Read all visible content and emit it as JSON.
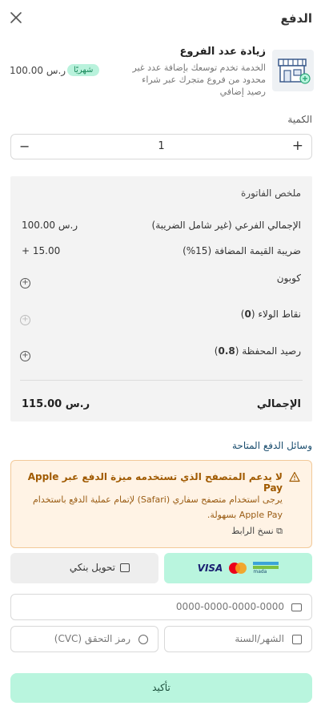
{
  "header": {
    "title": "الدفع",
    "close_icon": "close-icon"
  },
  "product": {
    "name": "زيادة عدد الفروع",
    "description": "الخدمة تخدم توسعك بإضافة عدد غير محدود من فروع متجرك عبر شراء رصيد إضافي",
    "billing_badge": "شهريًا",
    "price": "100.00 ر.س",
    "icon": "store-plus-icon"
  },
  "quantity": {
    "label": "الكمية",
    "value": "1",
    "minus": "−",
    "plus": "+"
  },
  "invoice": {
    "title": "ملخص الفاتورة",
    "subtotal_label": "الإجمالي الفرعي (غير شامل الضريبة)",
    "subtotal_value": "100.00 ر.س",
    "vat_label": "ضريبة القيمة المضافة (15%)",
    "vat_value": "+ 15.00",
    "coupon_label": "كوبون",
    "loyalty_label": "نقاط الولاء (",
    "loyalty_value": "0",
    "loyalty_close": ")",
    "wallet_label": "رصيد المحفظة (",
    "wallet_value": "0.8",
    "wallet_close": ")",
    "total_label": "الإجمالي",
    "total_value": "115.00 ر.س"
  },
  "payment_methods": {
    "title": "وسائل الدفع المتاحة",
    "warning_title": "لا يدعم المتصفح الذي تستخدمه ميزة الدفع عبر Apple Pay",
    "warning_body": "يرجى استخدام متصفح سفاري (Safari) لإتمام عملية الدفع باستخدام Apple Pay بسهولة.",
    "copy_link": "نسخ الرابط",
    "card_option": {
      "visa": "VISA",
      "mada": "mada"
    },
    "bank_transfer": "تحويل بنكي"
  },
  "card_form": {
    "card_number_placeholder": "0000-0000-0000-0000",
    "expiry_placeholder": "الشهر/السنة",
    "cvc_placeholder": "رمز التحقق (CVC)"
  },
  "confirm_button": "تأكيد",
  "colors": {
    "accent": "#b9f5de",
    "badge_text": "#1a8a5c",
    "warning_bg": "#fff3e5",
    "warning_text": "#a05a00",
    "invoice_bg": "#f3f3f3"
  }
}
